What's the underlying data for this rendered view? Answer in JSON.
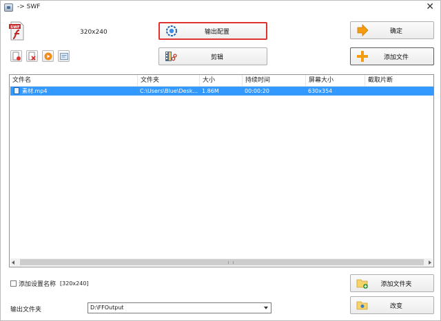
{
  "window": {
    "title": "-> SWF"
  },
  "top": {
    "size_label": "320x240"
  },
  "buttons": {
    "output_settings": "输出配置",
    "ok": "确定",
    "edit": "剪辑",
    "add_file": "添加文件",
    "add_folder": "添加文件夹",
    "change": "改变"
  },
  "toolbar_icons": [
    "new-icon",
    "delete-icon",
    "play-icon",
    "info-icon"
  ],
  "list": {
    "columns": [
      "文件名",
      "文件夹",
      "大小",
      "持续时间",
      "屏幕大小",
      "截取片断"
    ],
    "rows": [
      {
        "name": "素材.mp4",
        "folder": "C:\\Users\\Blue\\Desk...",
        "size": "1.86M",
        "duration": "00:00:20",
        "screen": "630x354",
        "clip": ""
      }
    ]
  },
  "bottom": {
    "checkbox_label": "添加设置名称",
    "checkbox_value": "[320x240]",
    "output_folder_label": "输出文件夹",
    "output_folder_value": "D:\\FFOutput"
  },
  "colors": {
    "selection": "#3399ff",
    "highlight_border": "#e03131"
  }
}
